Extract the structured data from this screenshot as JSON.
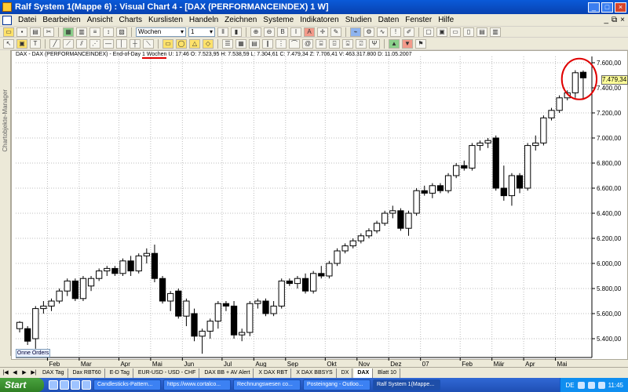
{
  "window": {
    "title": "Ralf System 1(Mappe 6) : Visual Chart 4 - [DAX (PERFORMANCEINDEX) 1 W]",
    "controls": [
      "_",
      "□",
      "×"
    ]
  },
  "menu": {
    "items": [
      "Datei",
      "Bearbeiten",
      "Ansicht",
      "Charts",
      "Kurslisten",
      "Handeln",
      "Zeichnen",
      "Systeme",
      "Indikatoren",
      "Studien",
      "Daten",
      "Fenster",
      "Hilfe"
    ],
    "mdi_controls": [
      "_",
      "⧉",
      "×"
    ]
  },
  "toolbar": {
    "period_value": "Wochen",
    "count_value": "1"
  },
  "side_panel": {
    "label": "Chartobjekte-Manager"
  },
  "chart_header": {
    "prefix": "DAX - DAX (PERFORMANCEINDEX) - End-of-Day",
    "period": "1 Wochen",
    "rest": "U: 17:46  O: 7.523,95  H: 7.538,59  L: 7.304,61  C: 7.479,34  Z: 7.706,41  V: 463.317.800  D: 11.05.2007"
  },
  "price_badge": "7.479,34",
  "onne_orders": "Onne Orders",
  "chart_data": {
    "type": "candlestick",
    "y_axis": {
      "min": 5250,
      "max": 7650,
      "ticks": [
        5400,
        5600,
        5800,
        6000,
        6200,
        6400,
        6600,
        6800,
        7000,
        7200,
        7400,
        7600
      ],
      "tick_labels": [
        "5.400,00",
        "5.600,00",
        "5.800,00",
        "6.000,00",
        "6.200,00",
        "6.400,00",
        "6.600,00",
        "6.800,00",
        "7.000,00",
        "7.200,00",
        "7.400,00",
        "7.600,00"
      ]
    },
    "x_axis": {
      "months": [
        {
          "label": "Feb",
          "index": 4
        },
        {
          "label": "Mar",
          "index": 8
        },
        {
          "label": "Apr",
          "index": 13
        },
        {
          "label": "Mai",
          "index": 17
        },
        {
          "label": "Jun",
          "index": 21
        },
        {
          "label": "Jul",
          "index": 26
        },
        {
          "label": "Aug",
          "index": 30
        },
        {
          "label": "Sep",
          "index": 34
        },
        {
          "label": "Okt",
          "index": 39
        },
        {
          "label": "Nov",
          "index": 43
        },
        {
          "label": "Dez",
          "index": 47
        },
        {
          "label": "07",
          "index": 51
        },
        {
          "label": "Feb",
          "index": 56
        },
        {
          "label": "Mär",
          "index": 60
        },
        {
          "label": "Apr",
          "index": 64
        },
        {
          "label": "Mai",
          "index": 68
        }
      ]
    },
    "candles": [
      {
        "o": 5480,
        "h": 5540,
        "l": 5450,
        "c": 5530
      },
      {
        "o": 5480,
        "h": 5500,
        "l": 5350,
        "c": 5380
      },
      {
        "o": 5400,
        "h": 5660,
        "l": 5320,
        "c": 5640
      },
      {
        "o": 5640,
        "h": 5700,
        "l": 5600,
        "c": 5660
      },
      {
        "o": 5660,
        "h": 5720,
        "l": 5620,
        "c": 5700
      },
      {
        "o": 5700,
        "h": 5800,
        "l": 5680,
        "c": 5780
      },
      {
        "o": 5780,
        "h": 5880,
        "l": 5740,
        "c": 5860
      },
      {
        "o": 5860,
        "h": 5880,
        "l": 5700,
        "c": 5720
      },
      {
        "o": 5720,
        "h": 5900,
        "l": 5700,
        "c": 5880
      },
      {
        "o": 5820,
        "h": 5900,
        "l": 5780,
        "c": 5880
      },
      {
        "o": 5880,
        "h": 5960,
        "l": 5860,
        "c": 5940
      },
      {
        "o": 5940,
        "h": 5980,
        "l": 5900,
        "c": 5960
      },
      {
        "o": 5960,
        "h": 5980,
        "l": 5900,
        "c": 5920
      },
      {
        "o": 5920,
        "h": 6040,
        "l": 5900,
        "c": 6020
      },
      {
        "o": 6020,
        "h": 6060,
        "l": 5900,
        "c": 5940
      },
      {
        "o": 5940,
        "h": 6080,
        "l": 5920,
        "c": 6060
      },
      {
        "o": 6060,
        "h": 6120,
        "l": 6000,
        "c": 6080
      },
      {
        "o": 6080,
        "h": 6150,
        "l": 5850,
        "c": 5880
      },
      {
        "o": 5880,
        "h": 5900,
        "l": 5680,
        "c": 5700
      },
      {
        "o": 5700,
        "h": 5780,
        "l": 5620,
        "c": 5760
      },
      {
        "o": 5780,
        "h": 5800,
        "l": 5560,
        "c": 5580
      },
      {
        "o": 5580,
        "h": 5720,
        "l": 5500,
        "c": 5700
      },
      {
        "o": 5600,
        "h": 5640,
        "l": 5380,
        "c": 5420
      },
      {
        "o": 5420,
        "h": 5480,
        "l": 5280,
        "c": 5460
      },
      {
        "o": 5460,
        "h": 5560,
        "l": 5400,
        "c": 5540
      },
      {
        "o": 5540,
        "h": 5700,
        "l": 5480,
        "c": 5680
      },
      {
        "o": 5680,
        "h": 5700,
        "l": 5620,
        "c": 5660
      },
      {
        "o": 5660,
        "h": 5700,
        "l": 5400,
        "c": 5430
      },
      {
        "o": 5430,
        "h": 5480,
        "l": 5380,
        "c": 5450
      },
      {
        "o": 5450,
        "h": 5700,
        "l": 5420,
        "c": 5680
      },
      {
        "o": 5680,
        "h": 5720,
        "l": 5640,
        "c": 5700
      },
      {
        "o": 5700,
        "h": 5720,
        "l": 5580,
        "c": 5600
      },
      {
        "o": 5600,
        "h": 5700,
        "l": 5580,
        "c": 5660
      },
      {
        "o": 5660,
        "h": 5880,
        "l": 5640,
        "c": 5860
      },
      {
        "o": 5860,
        "h": 5880,
        "l": 5820,
        "c": 5840
      },
      {
        "o": 5840,
        "h": 5900,
        "l": 5800,
        "c": 5880
      },
      {
        "o": 5880,
        "h": 5920,
        "l": 5760,
        "c": 5780
      },
      {
        "o": 5780,
        "h": 5940,
        "l": 5760,
        "c": 5920
      },
      {
        "o": 5920,
        "h": 5980,
        "l": 5880,
        "c": 5900
      },
      {
        "o": 5900,
        "h": 6020,
        "l": 5880,
        "c": 6000
      },
      {
        "o": 6000,
        "h": 6120,
        "l": 5980,
        "c": 6100
      },
      {
        "o": 6100,
        "h": 6160,
        "l": 6080,
        "c": 6140
      },
      {
        "o": 6140,
        "h": 6200,
        "l": 6120,
        "c": 6180
      },
      {
        "o": 6180,
        "h": 6240,
        "l": 6160,
        "c": 6220
      },
      {
        "o": 6220,
        "h": 6280,
        "l": 6200,
        "c": 6260
      },
      {
        "o": 6260,
        "h": 6340,
        "l": 6240,
        "c": 6320
      },
      {
        "o": 6320,
        "h": 6420,
        "l": 6300,
        "c": 6400
      },
      {
        "o": 6400,
        "h": 6460,
        "l": 6360,
        "c": 6420
      },
      {
        "o": 6420,
        "h": 6440,
        "l": 6260,
        "c": 6280
      },
      {
        "o": 6280,
        "h": 6420,
        "l": 6220,
        "c": 6400
      },
      {
        "o": 6400,
        "h": 6600,
        "l": 6380,
        "c": 6580
      },
      {
        "o": 6580,
        "h": 6620,
        "l": 6540,
        "c": 6560
      },
      {
        "o": 6560,
        "h": 6640,
        "l": 6520,
        "c": 6620
      },
      {
        "o": 6620,
        "h": 6640,
        "l": 6560,
        "c": 6580
      },
      {
        "o": 6580,
        "h": 6720,
        "l": 6560,
        "c": 6700
      },
      {
        "o": 6700,
        "h": 6800,
        "l": 6680,
        "c": 6780
      },
      {
        "o": 6780,
        "h": 6820,
        "l": 6740,
        "c": 6760
      },
      {
        "o": 6760,
        "h": 6960,
        "l": 6740,
        "c": 6940
      },
      {
        "o": 6940,
        "h": 6980,
        "l": 6900,
        "c": 6960
      },
      {
        "o": 6960,
        "h": 7000,
        "l": 6920,
        "c": 6980
      },
      {
        "o": 7000,
        "h": 7020,
        "l": 6580,
        "c": 6600
      },
      {
        "o": 6600,
        "h": 6780,
        "l": 6500,
        "c": 6540
      },
      {
        "o": 6540,
        "h": 6720,
        "l": 6460,
        "c": 6700
      },
      {
        "o": 6700,
        "h": 6720,
        "l": 6560,
        "c": 6600
      },
      {
        "o": 6600,
        "h": 6960,
        "l": 6580,
        "c": 6940
      },
      {
        "o": 6940,
        "h": 7020,
        "l": 6900,
        "c": 6960
      },
      {
        "o": 6960,
        "h": 7180,
        "l": 6940,
        "c": 7160
      },
      {
        "o": 7160,
        "h": 7240,
        "l": 7140,
        "c": 7220
      },
      {
        "o": 7220,
        "h": 7340,
        "l": 7200,
        "c": 7320
      },
      {
        "o": 7320,
        "h": 7380,
        "l": 7300,
        "c": 7360
      },
      {
        "o": 7360,
        "h": 7540,
        "l": 7320,
        "c": 7520
      },
      {
        "o": 7523.95,
        "h": 7538.59,
        "l": 7304.61,
        "c": 7479.34
      }
    ],
    "up_color": "#ffffff",
    "down_color": "#000000"
  },
  "sheet_tabs": {
    "items": [
      "DAX Tag",
      "Dax RBT60",
      "E-D Tag",
      "EUR-USD - USD - CHF",
      "DAX BB + AV Alert",
      "X DAX RBT",
      "X DAX BBSYS",
      "DX",
      "DAX",
      "Blatt 10"
    ],
    "active": "DAX"
  },
  "taskbar": {
    "start_label": "Start",
    "tasks": [
      "Candlesticks-Pattern...",
      "https://www.cortalco...",
      "Rechnungswesen co...",
      "Posteingang - Outloo...",
      "Ralf System 1(Mappe..."
    ],
    "active_task": "Ralf System 1(Mappe...",
    "lang": "DE",
    "clock": "11:45"
  },
  "colors": {
    "titlebar": "#0a5ad8",
    "highlight_circle": "#e00000",
    "grid": "#bdbdbd"
  }
}
